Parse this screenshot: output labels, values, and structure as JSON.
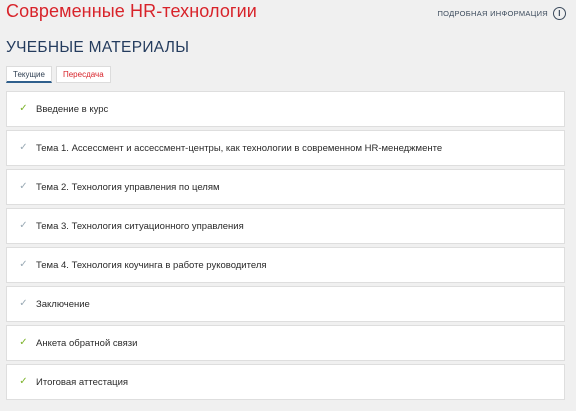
{
  "header": {
    "course_title": "Современные HR-технологии",
    "info_link": "ПОДРОБНАЯ ИНФОРМАЦИЯ"
  },
  "section": {
    "title": "УЧЕБНЫЕ МАТЕРИАЛЫ"
  },
  "tabs": [
    {
      "label": "Текущие",
      "active": true
    },
    {
      "label": "Пересдача",
      "active": false
    }
  ],
  "items": [
    {
      "label": "Введение в курс",
      "completed": true
    },
    {
      "label": "Тема 1. Ассессмент и ассессмент-центры, как технологии в современном HR-менеджменте",
      "completed": false
    },
    {
      "label": "Тема 2. Технология управления по целям",
      "completed": false
    },
    {
      "label": "Тема 3. Технология ситуационного управления",
      "completed": false
    },
    {
      "label": "Тема 4. Технология коучинга в работе руководителя",
      "completed": false
    },
    {
      "label": "Заключение",
      "completed": false
    },
    {
      "label": "Анкета обратной связи",
      "completed": true
    },
    {
      "label": "Итоговая аттестация",
      "completed": true
    }
  ],
  "colors": {
    "accent_red": "#d8232a",
    "heading_blue": "#243c5e",
    "check_done": "#7cb32a",
    "check_pending": "#9aaab5"
  },
  "icons": {
    "info": "info-icon",
    "check": "check-icon"
  }
}
